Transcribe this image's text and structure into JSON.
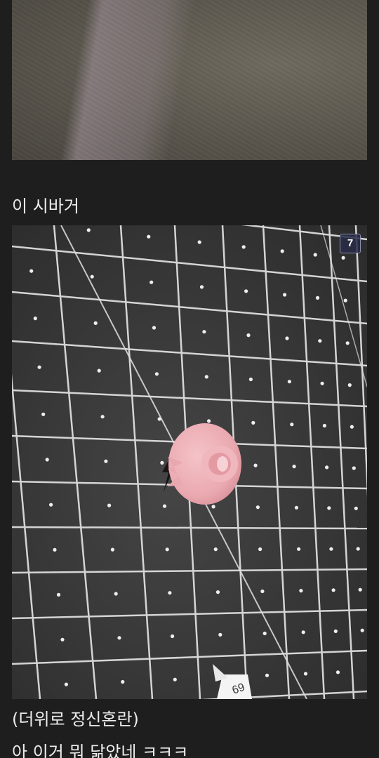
{
  "post": {
    "caption_1": "이 시바거",
    "caption_2": "(더위로 정신혼란)",
    "caption_3": "아 이거 뭐 닮았네 ㅋㅋㅋ"
  },
  "gallery": {
    "image_count_badge": "7"
  },
  "colors": {
    "background": "#1e1e1e",
    "text": "#ececec",
    "badge_bg": "#282c46"
  }
}
